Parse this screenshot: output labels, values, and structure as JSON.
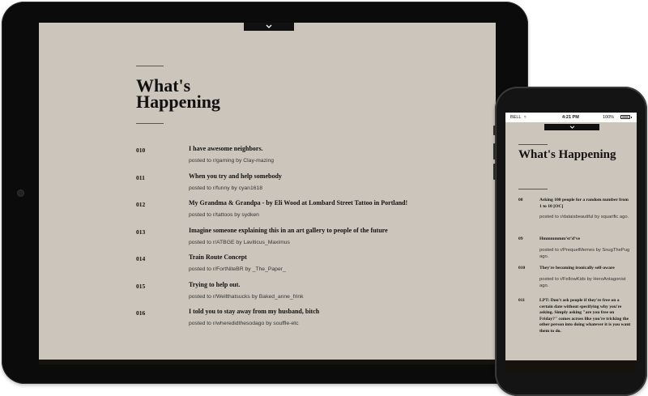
{
  "tablet": {
    "heading": "What's Happening",
    "handle_icon": "chevron-down-icon",
    "items": [
      {
        "num": "010",
        "title": "I have awesome neighbors.",
        "meta": "posted to r/gaming by Clay-mazing"
      },
      {
        "num": "011",
        "title": "When you try and help somebody",
        "meta": "posted to r/funny by cyan1618"
      },
      {
        "num": "012",
        "title": "My Grandma & Grandpa - by Eli Wood at Lombard Street Tattoo in Portland!",
        "meta": "posted to r/tattoos by sydken"
      },
      {
        "num": "013",
        "title": "Imagine someone explaining this in an art gallery to people of the future",
        "meta": "posted to r/ATBGE by Laviticus_Maximus"
      },
      {
        "num": "014",
        "title": "Train Route Concept",
        "meta": "posted to r/FortNiteBR by _The_Paper_"
      },
      {
        "num": "015",
        "title": "Trying to help out.",
        "meta": "posted to r/Wellthatsucks by Baked_anne_frink"
      },
      {
        "num": "016",
        "title": "I told you to stay away from my husband, bitch",
        "meta": "posted to r/wheredidthesodago by souffle-etc"
      }
    ]
  },
  "phone": {
    "status": {
      "carrier": "BELL",
      "time": "4:21 PM",
      "battery": "100%"
    },
    "heading": "What's Happening",
    "handle_icon": "chevron-down-icon",
    "items": [
      {
        "num": "08",
        "title": "Asking 100 people for a random number from 1 to 10 [OC]",
        "meta": "posted to r/dataisbeautiful by squarific ago."
      },
      {
        "num": "09",
        "title": "Hmmmmmm’st’d’ve",
        "meta": "posted to r/PrequelMemes by SnugThePug ago."
      },
      {
        "num": "010",
        "title": "They're becoming ironically self-aware",
        "meta": "posted to r/FellowKids by HeroAntagonist ago."
      },
      {
        "num": "011",
        "title": "LPT: Don't ask people if they're free on a certain date without specifying why you're asking. Simply asking \"are you free on Friday?\" comes across like you're tricking the other person into doing whatever it is you want them to do.",
        "meta": ""
      }
    ]
  }
}
